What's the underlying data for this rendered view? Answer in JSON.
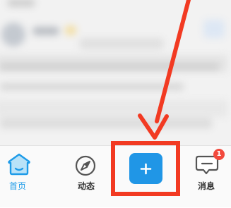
{
  "tab_bar": {
    "home_label": "首页",
    "dynamic_label": "动态",
    "messages_label": "消息",
    "messages_badge": "1",
    "active_tab": "home"
  },
  "publish_button": {
    "icon": "plus-icon"
  },
  "icons": {
    "home": "home-icon",
    "dynamic": "compass-icon",
    "messages": "chat-bubble-icon",
    "publish": "plus-icon"
  },
  "annotation": {
    "type": "arrow",
    "color": "#f23a22",
    "target": "publish_button"
  },
  "colors": {
    "accent": "#1e9be8",
    "publish_bg": "#2096e6",
    "badge": "#f24a3d",
    "annotation": "#f23a22"
  }
}
